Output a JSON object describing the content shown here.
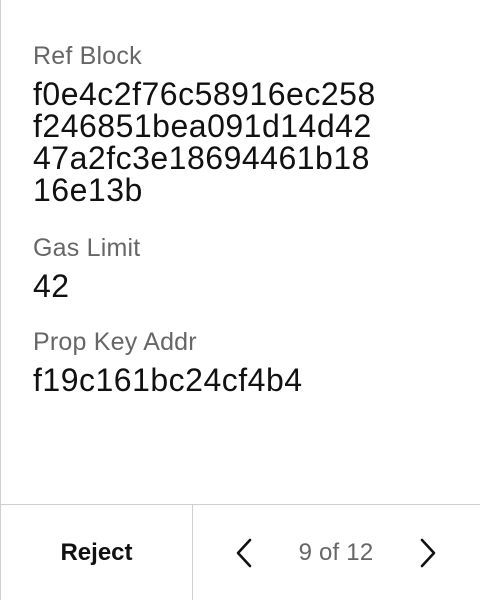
{
  "fields": {
    "ref_block": {
      "label": "Ref Block",
      "value_lines": [
        "f0e4c2f76c58916ec258",
        "f246851bea091d14d42",
        "47a2fc3e18694461b18",
        "16e13b"
      ]
    },
    "gas_limit": {
      "label": "Gas Limit",
      "value": "42"
    },
    "prop_key_addr": {
      "label": "Prop Key Addr",
      "value": "f19c161bc24cf4b4"
    }
  },
  "footer": {
    "reject_label": "Reject",
    "prev_icon": "chevron-left-icon",
    "next_icon": "chevron-right-icon",
    "page_indicator": "9 of 12"
  },
  "colors": {
    "label": "#666666",
    "value": "#111111",
    "divider": "#cfcfcf"
  }
}
